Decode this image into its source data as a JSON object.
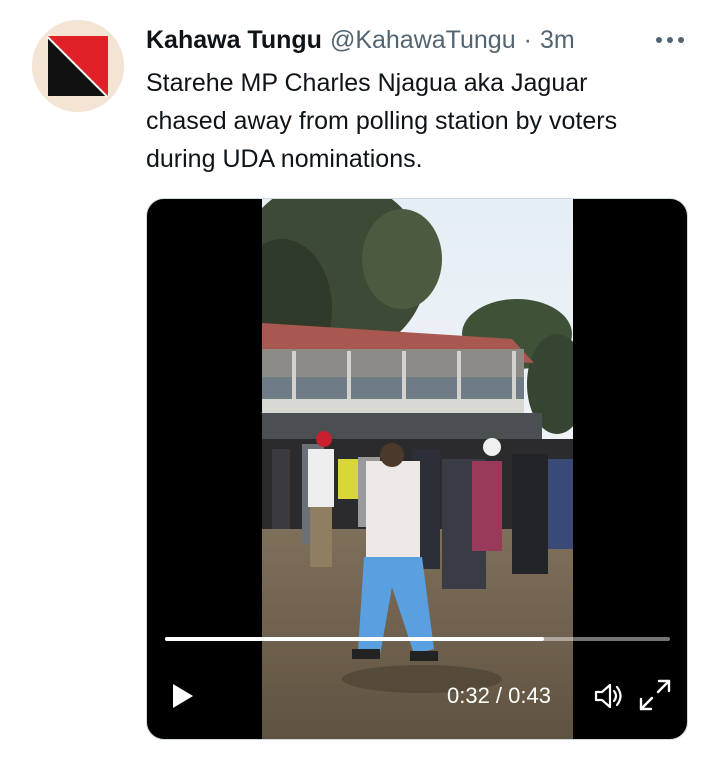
{
  "tweet": {
    "author": {
      "display_name": "Kahawa Tungu",
      "handle": "@KahawaTungu",
      "separator": "·",
      "time_ago": "3m",
      "avatar_colors": {
        "red": "#e02127",
        "black": "#111111",
        "white": "#ffffff",
        "backdrop": "#f4e4d4"
      }
    },
    "text_lines": [
      "Starehe MP Charles Njagua aka Jaguar",
      "chased away from polling station by voters",
      "during UDA nominations."
    ],
    "more_icon": "more-horizontal-icon"
  },
  "video": {
    "time_current": "0:32",
    "time_total": "0:43",
    "time_display": "0:32 / 0:43",
    "progress": 0.75,
    "controls": {
      "play_icon": "play-icon",
      "volume_icon": "volume-icon",
      "fullscreen_icon": "fullscreen-icon"
    }
  }
}
